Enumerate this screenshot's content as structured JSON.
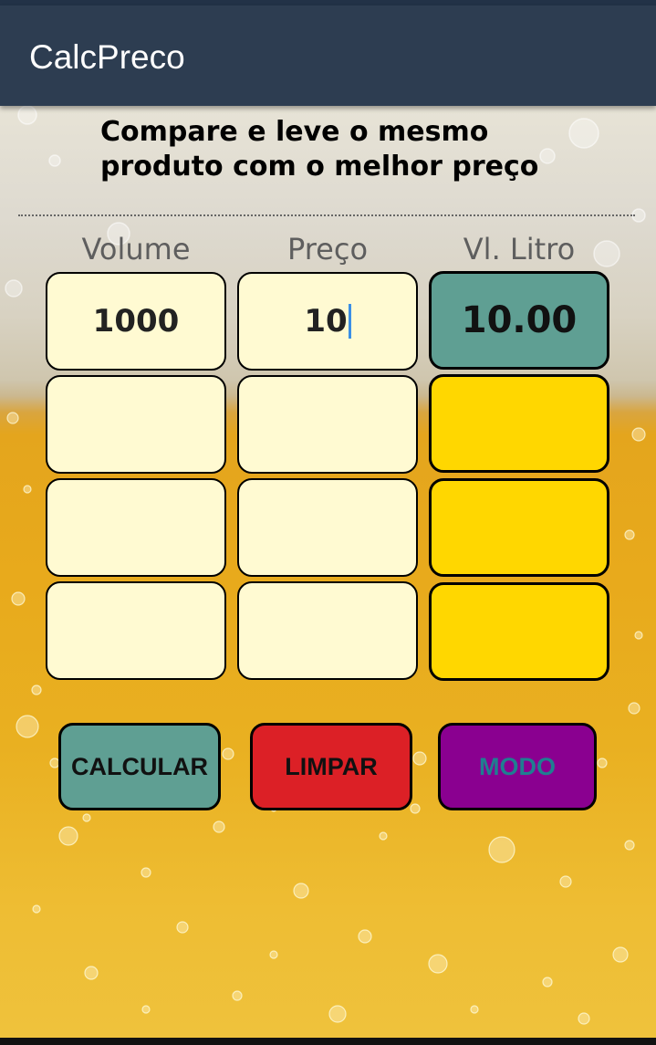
{
  "app": {
    "title": "CalcPreco"
  },
  "headline": {
    "line1": "Compare e leve o mesmo",
    "line2": "produto com o melhor preço"
  },
  "columns": {
    "volume": "Volume",
    "preco": "Preço",
    "litro": "Vl. Litro"
  },
  "rows": [
    {
      "volume": "1000",
      "preco": "10",
      "litro": "10.00"
    },
    {
      "volume": "",
      "preco": "",
      "litro": ""
    },
    {
      "volume": "",
      "preco": "",
      "litro": ""
    },
    {
      "volume": "",
      "preco": "",
      "litro": ""
    }
  ],
  "buttons": {
    "calcular": "CALCULAR",
    "limpar": "LIMPAR",
    "modo": "MODO"
  },
  "colors": {
    "app_bar": "#2d3d51",
    "input_bg": "#fffad2",
    "result_bg": "#ffd700",
    "result_best_bg": "#5f9f93",
    "calcular_bg": "#5f9f93",
    "limpar_bg": "#dc2026",
    "modo_bg": "#8a0090",
    "modo_text": "#1f7e91"
  }
}
